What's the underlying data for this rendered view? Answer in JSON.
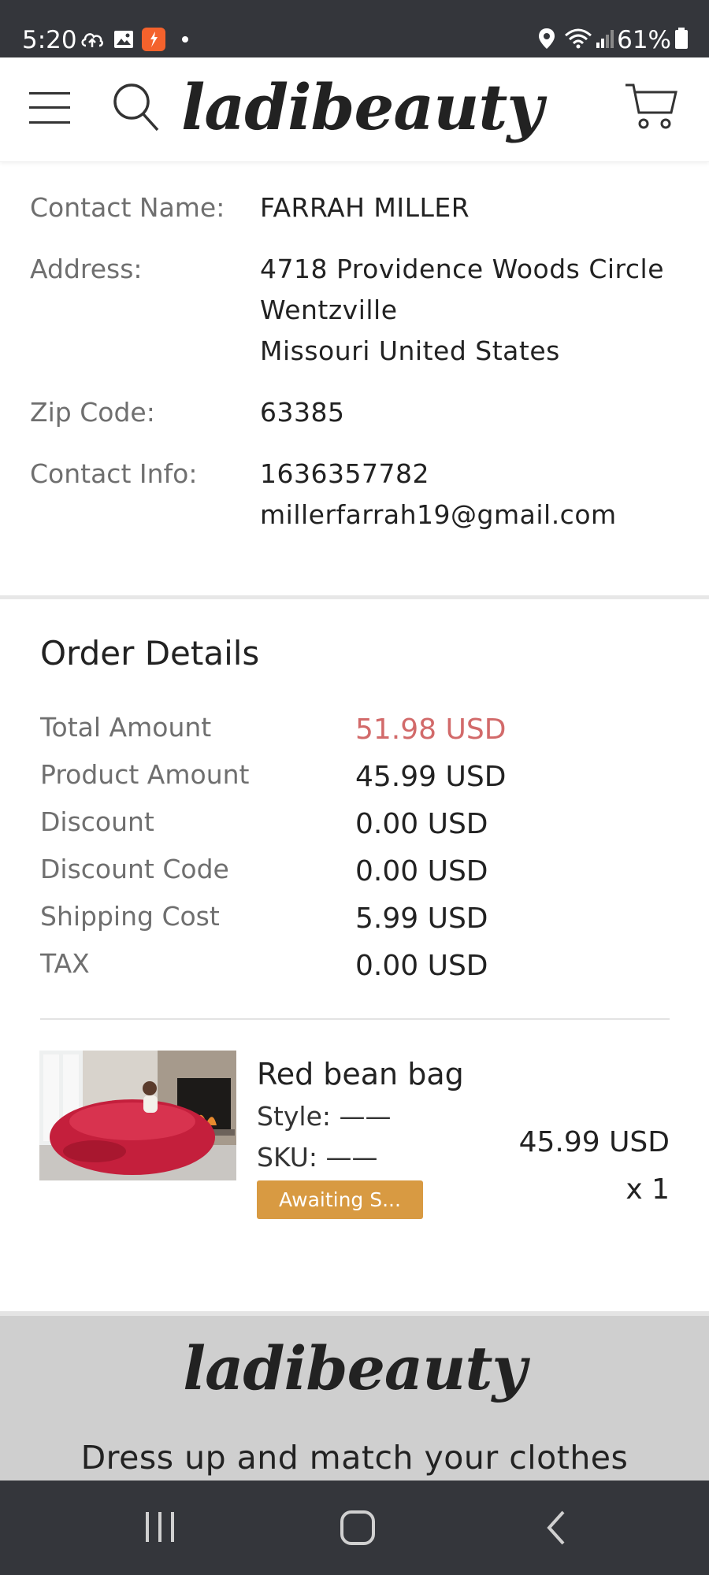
{
  "status_bar": {
    "time": "5:20",
    "battery": "61%",
    "icons": [
      "cloud-upload-icon",
      "gallery-icon",
      "flipboard-app-icon",
      "notification-dot-icon",
      "location-icon",
      "wifi-icon",
      "signal-icon",
      "battery-icon"
    ]
  },
  "header": {
    "logo": "ladibeauty",
    "menu_icon": "hamburger-menu-icon",
    "search_icon": "search-icon",
    "cart_icon": "cart-icon"
  },
  "contact": {
    "name_label": "Contact Name:",
    "name_value": "FARRAH MILLER",
    "address_label": "Address:",
    "address_line1": "4718 Providence Woods Circle",
    "address_line2": "Wentzville",
    "address_line3": "Missouri United States",
    "zip_label": "Zip Code:",
    "zip_value": "63385",
    "info_label": "Contact Info:",
    "phone": "1636357782",
    "email": "millerfarrah19@gmail.com"
  },
  "order": {
    "title": "Order Details",
    "rows": [
      {
        "label": "Total Amount",
        "value": "51.98 USD"
      },
      {
        "label": "Product Amount",
        "value": "45.99 USD"
      },
      {
        "label": "Discount",
        "value": "0.00 USD"
      },
      {
        "label": "Discount Code",
        "value": "0.00 USD"
      },
      {
        "label": "Shipping Cost",
        "value": "5.99 USD"
      },
      {
        "label": "TAX",
        "value": "0.00 USD"
      }
    ],
    "total_color": "#d26a6a"
  },
  "product": {
    "name": "Red bean bag",
    "style": "Style: ——",
    "sku": "SKU: ——",
    "price": "45.99 USD",
    "quantity": "x 1",
    "status": "Awaiting S...",
    "status_color": "#d89a42"
  },
  "footer": {
    "logo": "ladibeauty",
    "tagline": "Dress up and match your clothes"
  },
  "nav_bar": {
    "recents_icon": "recent-apps-icon",
    "home_icon": "home-icon",
    "back_icon": "back-icon"
  }
}
